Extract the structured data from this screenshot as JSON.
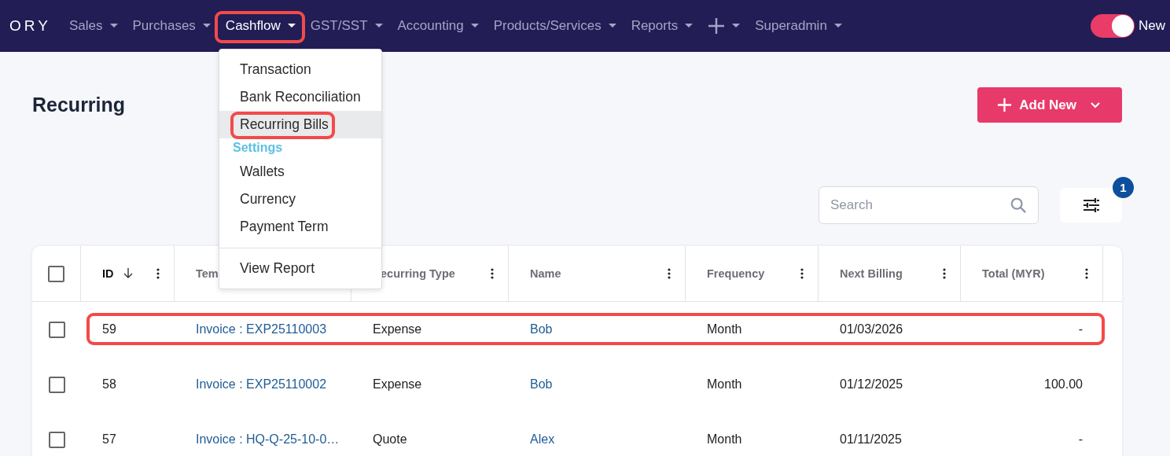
{
  "topbar": {
    "logo": "ORY",
    "nav": [
      {
        "kind": "text",
        "label": "Sales",
        "selected": false,
        "highlighted": false
      },
      {
        "kind": "text",
        "label": "Purchases",
        "selected": false,
        "highlighted": false
      },
      {
        "kind": "text",
        "label": "Cashflow",
        "selected": true,
        "highlighted": true
      },
      {
        "kind": "text",
        "label": "GST/SST",
        "selected": false,
        "highlighted": false
      },
      {
        "kind": "text",
        "label": "Accounting",
        "selected": false,
        "highlighted": false
      },
      {
        "kind": "text",
        "label": "Products/Services",
        "selected": false,
        "highlighted": false
      },
      {
        "kind": "text",
        "label": "Reports",
        "selected": false,
        "highlighted": false
      },
      {
        "kind": "add",
        "selected": false,
        "highlighted": false
      },
      {
        "kind": "text",
        "label": "Superadmin",
        "selected": false,
        "highlighted": false
      }
    ],
    "toggle": {
      "on": true,
      "label": "New"
    }
  },
  "dropdown": {
    "items": [
      {
        "kind": "item",
        "label": "Transaction",
        "hovered": false,
        "highlighted": false
      },
      {
        "kind": "item",
        "label": "Bank Reconciliation",
        "hovered": false,
        "highlighted": false
      },
      {
        "kind": "item",
        "label": "Recurring Bills",
        "hovered": true,
        "highlighted": true
      },
      {
        "kind": "heading",
        "label": "Settings"
      },
      {
        "kind": "item",
        "label": "Wallets",
        "hovered": false,
        "highlighted": false
      },
      {
        "kind": "item",
        "label": "Currency",
        "hovered": false,
        "highlighted": false
      },
      {
        "kind": "item",
        "label": "Payment Term",
        "hovered": false,
        "highlighted": false
      },
      {
        "kind": "divider"
      },
      {
        "kind": "item",
        "label": "View Report",
        "hovered": false,
        "highlighted": false
      }
    ]
  },
  "page": {
    "title": "Recurring",
    "add_button": "Add New",
    "search": {
      "placeholder": "Search"
    },
    "filter_badge": "1"
  },
  "table": {
    "columns": [
      {
        "label": "ID",
        "kind": "text",
        "sorted": true,
        "menu": true
      },
      {
        "label": "Tem",
        "kind": "link",
        "sorted": false,
        "menu": false
      },
      {
        "label": "ecurring Type",
        "kind": "text",
        "sorted": false,
        "menu": true
      },
      {
        "label": "Name",
        "kind": "link",
        "sorted": false,
        "menu": true
      },
      {
        "label": "Frequency",
        "kind": "text",
        "sorted": false,
        "menu": true
      },
      {
        "label": "Next Billing",
        "kind": "text",
        "sorted": false,
        "menu": true
      },
      {
        "label": "Total (MYR)",
        "kind": "amount",
        "sorted": false,
        "menu": true
      }
    ],
    "select_all": false,
    "rows": [
      {
        "checked": false,
        "highlighted": true,
        "cells": [
          "59",
          "Invoice : EXP25110003",
          "Expense",
          "Bob",
          "Month",
          "01/03/2026",
          "-"
        ]
      },
      {
        "checked": false,
        "highlighted": false,
        "cells": [
          "58",
          "Invoice : EXP25110002",
          "Expense",
          "Bob",
          "Month",
          "01/12/2025",
          "100.00"
        ]
      },
      {
        "checked": false,
        "highlighted": false,
        "cells": [
          "57",
          "Invoice : HQ-Q-25-10-0…",
          "Quote",
          "Alex",
          "Month",
          "01/11/2025",
          "-"
        ]
      }
    ]
  }
}
